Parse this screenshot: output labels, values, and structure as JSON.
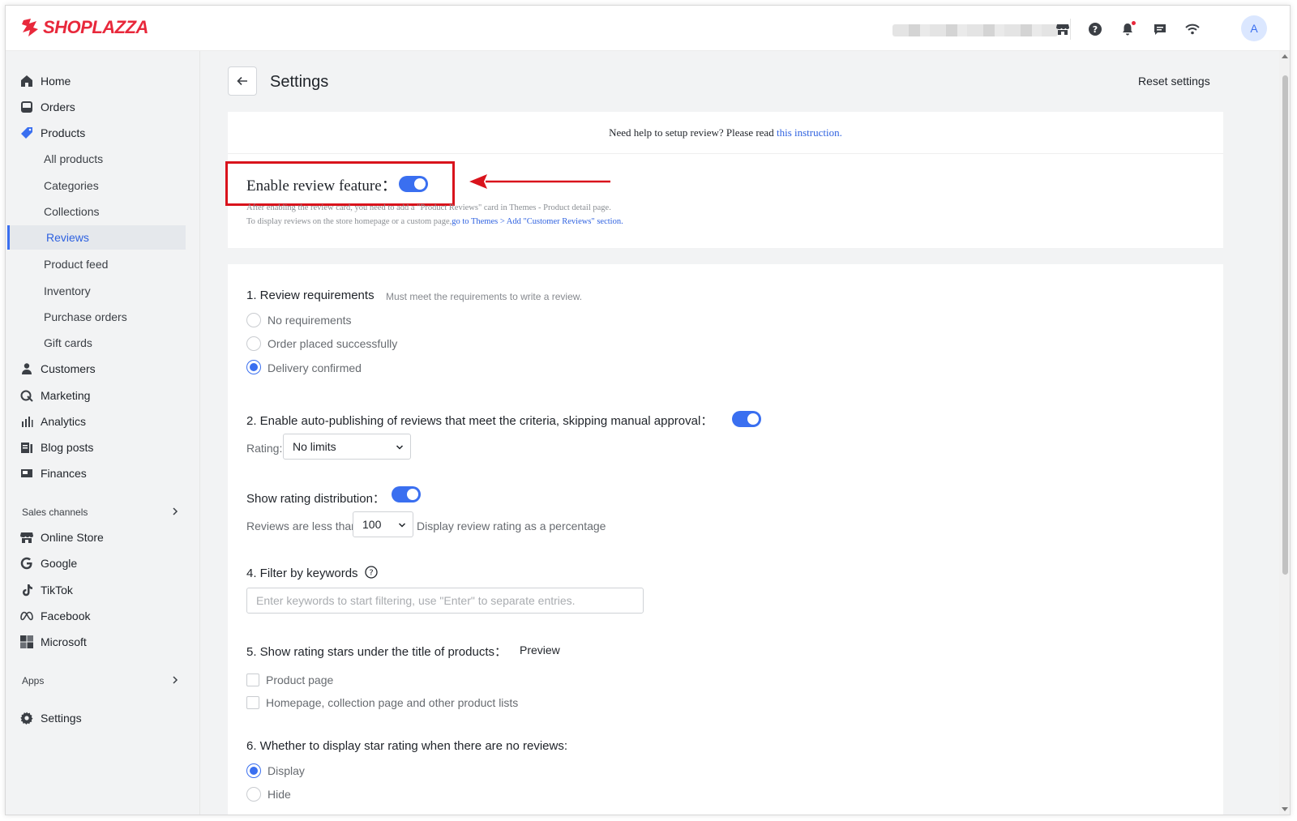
{
  "brand": {
    "name": "SHOPLAZZA",
    "color": "#e8283b"
  },
  "accent": "#3a6ff0",
  "topbar": {
    "icons": [
      "store-icon",
      "help-icon",
      "bell-icon",
      "chat-icon",
      "wifi-icon"
    ],
    "avatar_initial": "A"
  },
  "sidebar": {
    "items": [
      {
        "label": "Home",
        "icon": "home-icon"
      },
      {
        "label": "Orders",
        "icon": "orders-icon"
      },
      {
        "label": "Products",
        "icon": "tag-icon"
      },
      {
        "label": "All products"
      },
      {
        "label": "Categories"
      },
      {
        "label": "Collections"
      },
      {
        "label": "Reviews",
        "active": true
      },
      {
        "label": "Product feed"
      },
      {
        "label": "Inventory"
      },
      {
        "label": "Purchase orders"
      },
      {
        "label": "Gift cards"
      },
      {
        "label": "Customers",
        "icon": "user-icon"
      },
      {
        "label": "Marketing",
        "icon": "marketing-icon"
      },
      {
        "label": "Analytics",
        "icon": "analytics-icon"
      },
      {
        "label": "Blog posts",
        "icon": "blog-icon"
      },
      {
        "label": "Finances",
        "icon": "finances-icon"
      }
    ],
    "sales_channels_title": "Sales channels",
    "channels": [
      {
        "label": "Online Store",
        "icon": "store-icon"
      },
      {
        "label": "Google",
        "icon": "google-icon"
      },
      {
        "label": "TikTok",
        "icon": "tiktok-icon"
      },
      {
        "label": "Facebook",
        "icon": "meta-icon"
      },
      {
        "label": "Microsoft",
        "icon": "microsoft-icon"
      }
    ],
    "apps_title": "Apps",
    "settings_label": "Settings"
  },
  "page": {
    "title": "Settings",
    "reset_label": "Reset settings"
  },
  "help": {
    "text": "Need help to setup review? Please read ",
    "link": "this instruction."
  },
  "enable": {
    "label": "Enable review feature：",
    "enabled": true,
    "hint1": "After enabling the review card, you need to add a \"Product Reviews\" card in Themes - Product detail page.",
    "hint2_prefix": "To display reviews on the store homepage or a custom page,",
    "hint2_link": "go to Themes > Add \"Customer Reviews\" section."
  },
  "requirements": {
    "title": "1. Review requirements",
    "subtitle": "Must meet the requirements to write a review.",
    "options": [
      "No requirements",
      "Order placed successfully",
      "Delivery confirmed"
    ],
    "selected": "Delivery confirmed"
  },
  "auto_publish": {
    "title": "2. Enable auto-publishing of reviews that meet the criteria, skipping manual approval：",
    "enabled": true,
    "rating_label": "Rating:",
    "rating_value": "No limits"
  },
  "distribution": {
    "title": "Show rating distribution：",
    "enabled": true,
    "prefix": "Reviews are less than",
    "value": "100",
    "suffix": "Display review rating as a percentage"
  },
  "keywords": {
    "title": "4. Filter by keywords",
    "placeholder": "Enter keywords to start filtering, use \"Enter\" to separate entries."
  },
  "stars": {
    "title": "5. Show rating stars under the title of products：",
    "preview_link": "Preview",
    "options": [
      "Product page",
      "Homepage, collection page and other product lists"
    ]
  },
  "no_reviews": {
    "title": "6. Whether to display star rating when there are no reviews:",
    "options": [
      "Display",
      "Hide"
    ],
    "selected": "Display"
  }
}
